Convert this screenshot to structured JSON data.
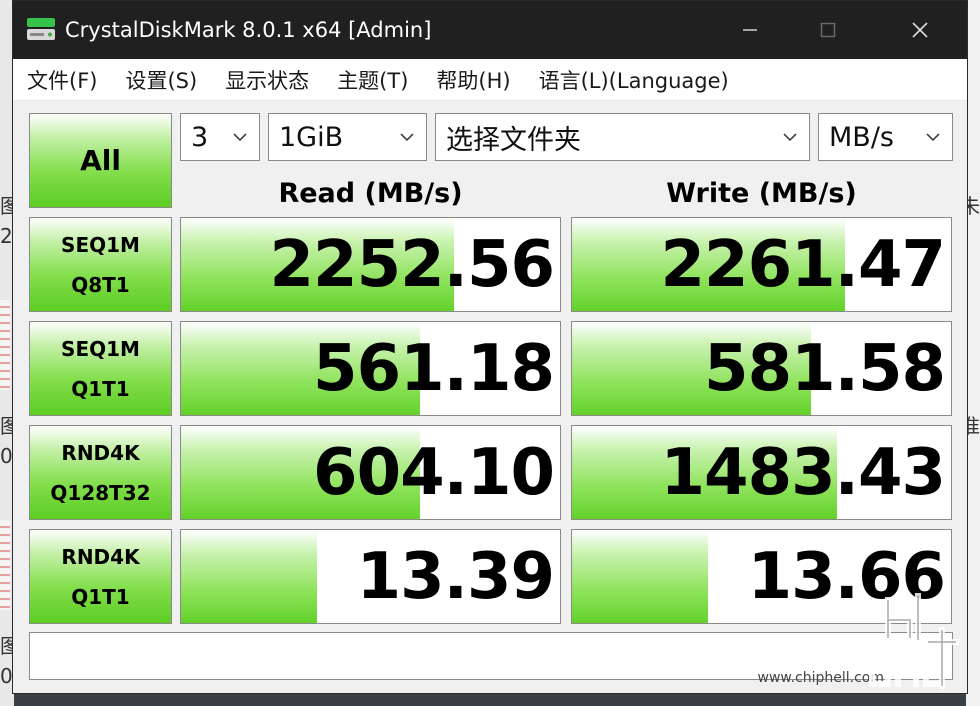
{
  "window": {
    "title": "CrystalDiskMark 8.0.1 x64 [Admin]",
    "icon": "disk-icon"
  },
  "menu": [
    "文件(F)",
    "设置(S)",
    "显示状态",
    "主题(T)",
    "帮助(H)",
    "语言(L)(Language)"
  ],
  "controls": {
    "all_label": "All",
    "count": "3",
    "size": "1GiB",
    "folder": "选择文件夹",
    "unit": "MB/s"
  },
  "headers": {
    "read": "Read (MB/s)",
    "write": "Write (MB/s)"
  },
  "tests": [
    {
      "line1": "SEQ1M",
      "line2": "Q8T1",
      "read": "2252.56",
      "write": "2261.47",
      "read_fill": 0.72,
      "write_fill": 0.72
    },
    {
      "line1": "SEQ1M",
      "line2": "Q1T1",
      "read": "561.18",
      "write": "581.58",
      "read_fill": 0.63,
      "write_fill": 0.63
    },
    {
      "line1": "RND4K",
      "line2": "Q128T32",
      "read": "604.10",
      "write": "1483.43",
      "read_fill": 0.63,
      "write_fill": 0.7
    },
    {
      "line1": "RND4K",
      "line2": "Q1T1",
      "read": "13.39",
      "write": "13.66",
      "read_fill": 0.36,
      "write_fill": 0.36
    }
  ],
  "comment": "",
  "desktop": {
    "glyph_left": "图",
    "glyph_right": "未",
    "digit_left": "2",
    "digit_left_b": "0",
    "glyph_right_b": "准"
  },
  "watermark": {
    "url": "www.chiphell.com",
    "logo": "chiphell-logo"
  },
  "colors": {
    "titlebar": "#202020",
    "bar_green": "#63d22c",
    "button_green": "#5ccd22"
  }
}
